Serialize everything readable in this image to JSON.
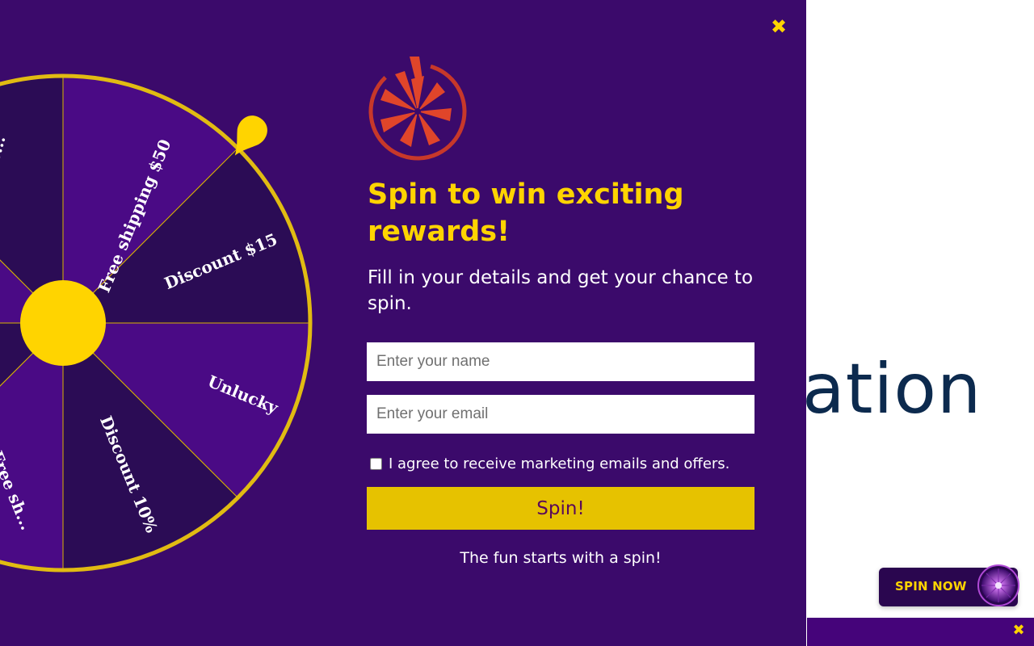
{
  "background_page": {
    "heading_fragment": "ation"
  },
  "popup": {
    "title": "Spin to win exciting rewards!",
    "subtitle": "Fill in your details and get your chance to spin.",
    "name_placeholder": "Enter your name",
    "email_placeholder": "Enter your email",
    "consent_label": "I agree to receive marketing emails and offers.",
    "spin_button": "Spin!",
    "footer": "The fun starts with a spin!",
    "close_icon": "close-icon"
  },
  "wheel": {
    "segments": [
      {
        "label": "Free shipping $50"
      },
      {
        "label": "Discount $15"
      },
      {
        "label": "Unlucky"
      },
      {
        "label": "Discount 10%"
      },
      {
        "label": "Free sh..."
      },
      {
        "label": "Disco..."
      }
    ]
  },
  "floating": {
    "spin_now_label": "SPIN NOW"
  },
  "colors": {
    "popup_bg": "#3b0a6b",
    "accent_yellow": "#ffd400",
    "segment_light": "#4a0a85",
    "segment_dark": "#2b0c55",
    "spin_button_bg": "#e6c200",
    "logo_red": "#e0452a"
  }
}
